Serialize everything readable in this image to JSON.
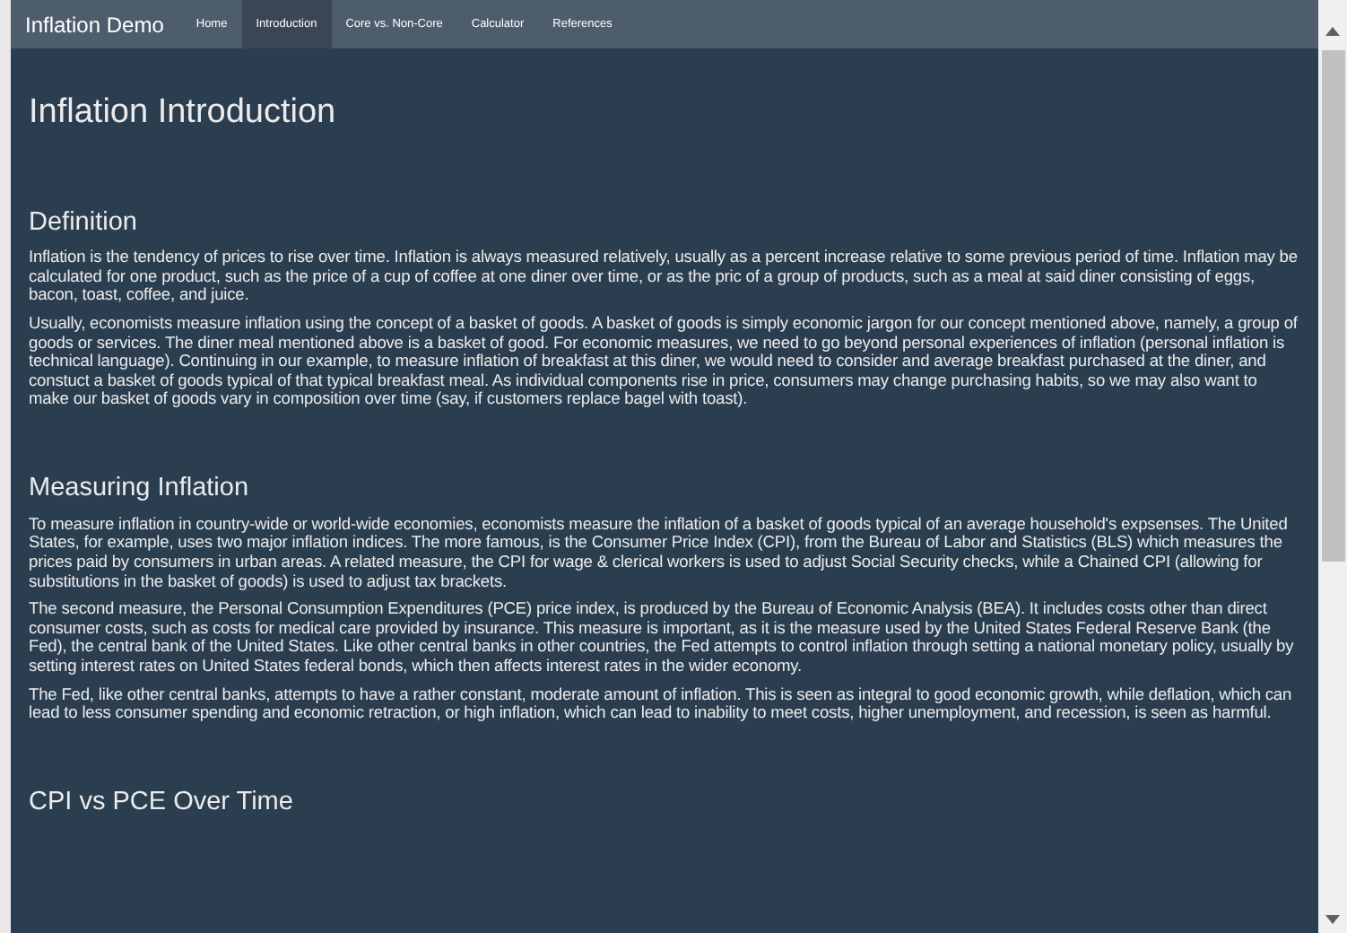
{
  "navbar": {
    "brand": "Inflation Demo",
    "items": [
      {
        "label": "Home",
        "selected": false
      },
      {
        "label": "Introduction",
        "selected": true
      },
      {
        "label": "Core vs. Non-Core",
        "selected": false
      },
      {
        "label": "Calculator",
        "selected": false
      },
      {
        "label": "References",
        "selected": false
      }
    ]
  },
  "page_title": "Inflation Introduction",
  "sections": [
    {
      "heading": "Definition",
      "paragraphs": [
        "Inflation is the tendency of prices to rise over time. Inflation is always measured relatively, usually as a percent increase relative to some previous period of time. Inflation may be calculated for one product, such as the price of a cup of coffee at one diner over time, or as the pric of a group of products, such as a meal at said diner consisting of eggs, bacon, toast, coffee, and juice.",
        "Usually, economists measure inflation using the concept of a basket of goods. A basket of goods is simply economic jargon for our concept mentioned above, namely, a group of goods or services. The diner meal mentioned above is a basket of good. For economic measures, we need to go beyond personal experiences of inflation (personal inflation is technical language). Continuing in our example, to measure inflation of breakfast at this diner, we would need to consider and average breakfast purchased at the diner, and constuct a basket of goods typical of that typical breakfast meal. As individual components rise in price, consumers may change purchasing habits, so we may also want to make our basket of goods vary in composition over time (say, if customers replace bagel with toast)."
      ]
    },
    {
      "heading": "Measuring Inflation",
      "paragraphs": [
        "To measure inflation in country-wide or world-wide economies, economists measure the inflation of a basket of goods typical of an average household's expsenses. The United States, for example, uses two major inflation indices. The more famous, is the Consumer Price Index (CPI), from the Bureau of Labor and Statistics (BLS) which measures the prices paid by consumers in urban areas. A related measure, the CPI for wage & clerical workers is used to adjust Social Security checks, while a Chained CPI (allowing for substitutions in the basket of goods) is used to adjust tax brackets.",
        "The second measure, the Personal Consumption Expenditures (PCE) price index, is produced by the Bureau of Economic Analysis (BEA). It includes costs other than direct consumer costs, such as costs for medical care provided by insurance. This measure is important, as it is the measure used by the United States Federal Reserve Bank (the Fed), the central bank of the United States. Like other central banks in other countries, the Fed attempts to control inflation through setting a national monetary policy, usually by setting interest rates on United States federal bonds, which then affects interest rates in the wider economy.",
        "The Fed, like other central banks, attempts to have a rather constant, moderate amount of inflation. This is seen as integral to good economic growth, while deflation, which can lead to less consumer spending and economic retraction, or high inflation, which can lead to inability to meet costs, higher unemployment, and recession, is seen as harmful."
      ]
    },
    {
      "heading": "CPI vs PCE Over Time"
    }
  ]
}
